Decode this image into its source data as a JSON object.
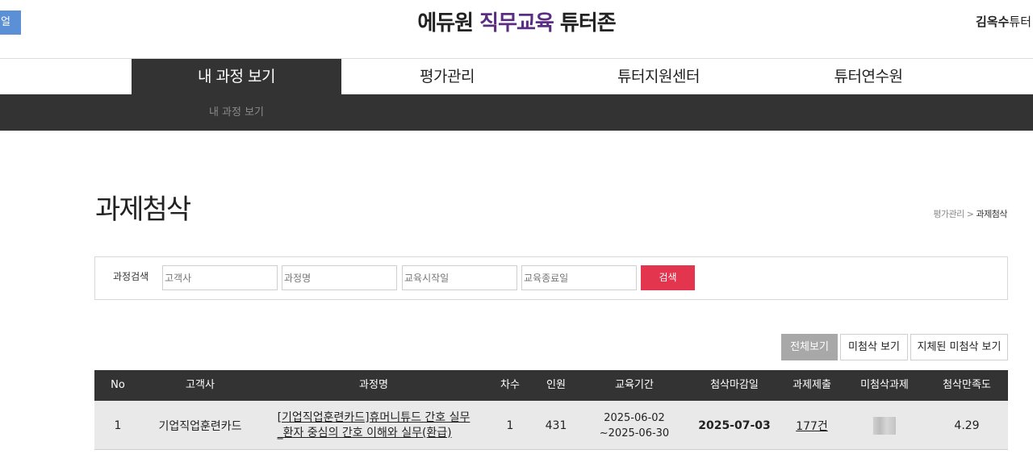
{
  "header": {
    "corner_button": "얼",
    "title_part1": "에듀원 ",
    "title_accent": "직무교육",
    "title_part2": " 튜터존",
    "user_name": "김옥수",
    "user_role": "튜터"
  },
  "nav": {
    "items": [
      "내 과정 보기",
      "평가관리",
      "튜터지원센터",
      "튜터연수원"
    ],
    "active_index": 0,
    "subnav_item": "내 과정 보기"
  },
  "page": {
    "title": "과제첨삭",
    "breadcrumb_parent": "평가관리",
    "breadcrumb_sep": ">",
    "breadcrumb_current": "과제첨삭"
  },
  "search": {
    "label": "과정검색",
    "client_placeholder": "고객사",
    "course_placeholder": "과정명",
    "start_placeholder": "교육시작일",
    "end_placeholder": "교육종료일",
    "button": "검색"
  },
  "filters": {
    "all": "전체보기",
    "unmarked": "미첨삭 보기",
    "delayed": "지체된 미첨삭 보기"
  },
  "table": {
    "headers": [
      "No",
      "고객사",
      "과정명",
      "차수",
      "인원",
      "교육기간",
      "첨삭마감일",
      "과제제출",
      "미첨삭과제",
      "첨삭만족도"
    ],
    "rows": [
      {
        "no": "1",
        "client": "기업직업훈련카드",
        "course_line1": "[기업직업훈련카드]휴머니튜드 간호 실무",
        "course_line2": "_환자 중심의 간호 이해와 실무(환급)",
        "round": "1",
        "people": "431",
        "period_start": "2025-06-02",
        "period_end": "~2025-06-30",
        "deadline": "2025-07-03",
        "submitted": "177건",
        "satisfaction": "4.29"
      }
    ]
  },
  "colors": {
    "accent": "#5a2d82",
    "nav_dark": "#333333",
    "search_button": "#e3354e"
  }
}
